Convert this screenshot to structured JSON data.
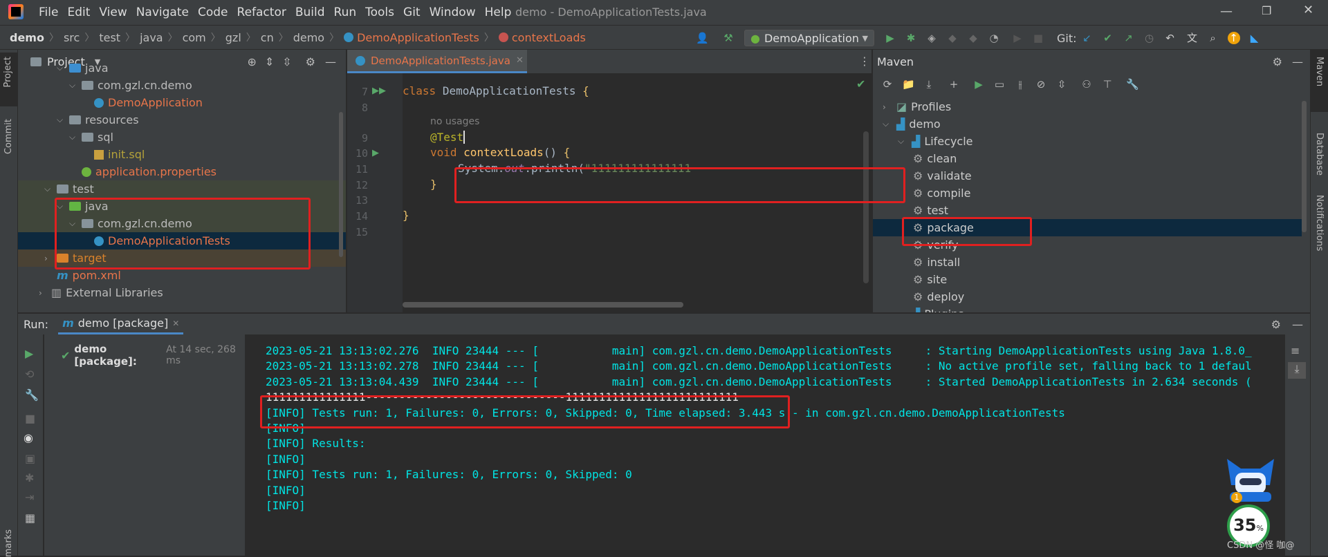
{
  "titlebar": {
    "menu": [
      "File",
      "Edit",
      "View",
      "Navigate",
      "Code",
      "Refactor",
      "Build",
      "Run",
      "Tools",
      "Git",
      "Window",
      "Help"
    ],
    "title": "demo - DemoApplicationTests.java"
  },
  "navbar": {
    "breadcrumbs": [
      "demo",
      "src",
      "test",
      "java",
      "com",
      "gzl",
      "cn",
      "demo",
      "DemoApplicationTests",
      "contextLoads"
    ],
    "run_config": "DemoApplication",
    "git_label": "Git:"
  },
  "left_strip": {
    "project": "Project",
    "commit": "Commit",
    "bookmarks": "marks"
  },
  "right_strip": {
    "maven": "Maven",
    "database": "Database",
    "notifications": "Notifications"
  },
  "project_panel": {
    "title": "Project",
    "tree": [
      {
        "label": "java",
        "indent": 1,
        "kind": "folder-blue",
        "expanded": true
      },
      {
        "label": "com.gzl.cn.demo",
        "indent": 2,
        "kind": "package",
        "expanded": true
      },
      {
        "label": "DemoApplication",
        "indent": 3,
        "kind": "class"
      },
      {
        "label": "resources",
        "indent": 1,
        "kind": "folder",
        "expanded": true
      },
      {
        "label": "sql",
        "indent": 2,
        "kind": "folder",
        "expanded": true
      },
      {
        "label": "init.sql",
        "indent": 3,
        "kind": "sql"
      },
      {
        "label": "application.properties",
        "indent": 2,
        "kind": "props"
      },
      {
        "label": "test",
        "indent": 0,
        "kind": "folder",
        "expanded": true
      },
      {
        "label": "java",
        "indent": 1,
        "kind": "folder-green",
        "expanded": true
      },
      {
        "label": "com.gzl.cn.demo",
        "indent": 2,
        "kind": "package",
        "expanded": true
      },
      {
        "label": "DemoApplicationTests",
        "indent": 3,
        "kind": "class",
        "selected": true
      },
      {
        "label": "target",
        "indent": 0,
        "kind": "folder-orange",
        "expanded": false
      },
      {
        "label": "pom.xml",
        "indent": 0,
        "kind": "maven"
      },
      {
        "label": "External Libraries",
        "indent": -1,
        "kind": "libs",
        "expanded": false
      }
    ]
  },
  "editor": {
    "tab": "DemoApplicationTests.java",
    "lines": [
      {
        "num": "7",
        "text": "class DemoApplicationTests {"
      },
      {
        "num": "8",
        "text": ""
      },
      {
        "num": "",
        "text": "no usages"
      },
      {
        "num": "9",
        "text": "@Test"
      },
      {
        "num": "10",
        "text": "void contextLoads() {"
      },
      {
        "num": "11",
        "text": "System.out.println(\"111111111111111-----------------------"
      },
      {
        "num": "12",
        "text": "}"
      },
      {
        "num": "13",
        "text": ""
      },
      {
        "num": "14",
        "text": "}"
      },
      {
        "num": "15",
        "text": ""
      }
    ]
  },
  "maven_panel": {
    "title": "Maven",
    "tree": [
      {
        "label": "Profiles",
        "indent": 0
      },
      {
        "label": "demo",
        "indent": 0
      },
      {
        "label": "Lifecycle",
        "indent": 1
      },
      {
        "label": "clean",
        "indent": 2
      },
      {
        "label": "validate",
        "indent": 2
      },
      {
        "label": "compile",
        "indent": 2
      },
      {
        "label": "test",
        "indent": 2
      },
      {
        "label": "package",
        "indent": 2,
        "selected": true
      },
      {
        "label": "verify",
        "indent": 2
      },
      {
        "label": "install",
        "indent": 2
      },
      {
        "label": "site",
        "indent": 2
      },
      {
        "label": "deploy",
        "indent": 2
      },
      {
        "label": "Plugins",
        "indent": 1
      }
    ]
  },
  "run_panel": {
    "label": "Run:",
    "tab": "demo [package]",
    "result_name": "demo [package]:",
    "result_time": "At 14 sec, 268 ms",
    "console": [
      "2023-05-21 13:13:02.276  INFO 23444 --- [           main] com.gzl.cn.demo.DemoApplicationTests     : Starting DemoApplicationTests using Java 1.8.0_",
      "2023-05-21 13:13:02.278  INFO 23444 --- [           main] com.gzl.cn.demo.DemoApplicationTests     : No active profile set, falling back to 1 defaul",
      "2023-05-21 13:13:04.439  INFO 23444 --- [           main] com.gzl.cn.demo.DemoApplicationTests     : Started DemoApplicationTests in 2.634 seconds (",
      "111111111111111------------------------------11111111111111111111111111",
      "[INFO] Tests run: 1, Failures: 0, Errors: 0, Skipped: 0, Time elapsed: 3.443 s - in com.gzl.cn.demo.DemoApplicationTests",
      "[INFO]",
      "[INFO] Results:",
      "[INFO]",
      "[INFO] Tests run: 1, Failures: 0, Errors: 0, Skipped: 0",
      "[INFO]",
      "[INFO]"
    ]
  },
  "overlay": {
    "percent": "35",
    "percent_unit": "%",
    "badge": "1",
    "watermark": "CSDN @怪 咖@"
  },
  "colors": {
    "accent_red": "#e02020",
    "selection": "#0d293e",
    "orange_text": "#e8754a",
    "cyan_console": "#00e5e5"
  }
}
